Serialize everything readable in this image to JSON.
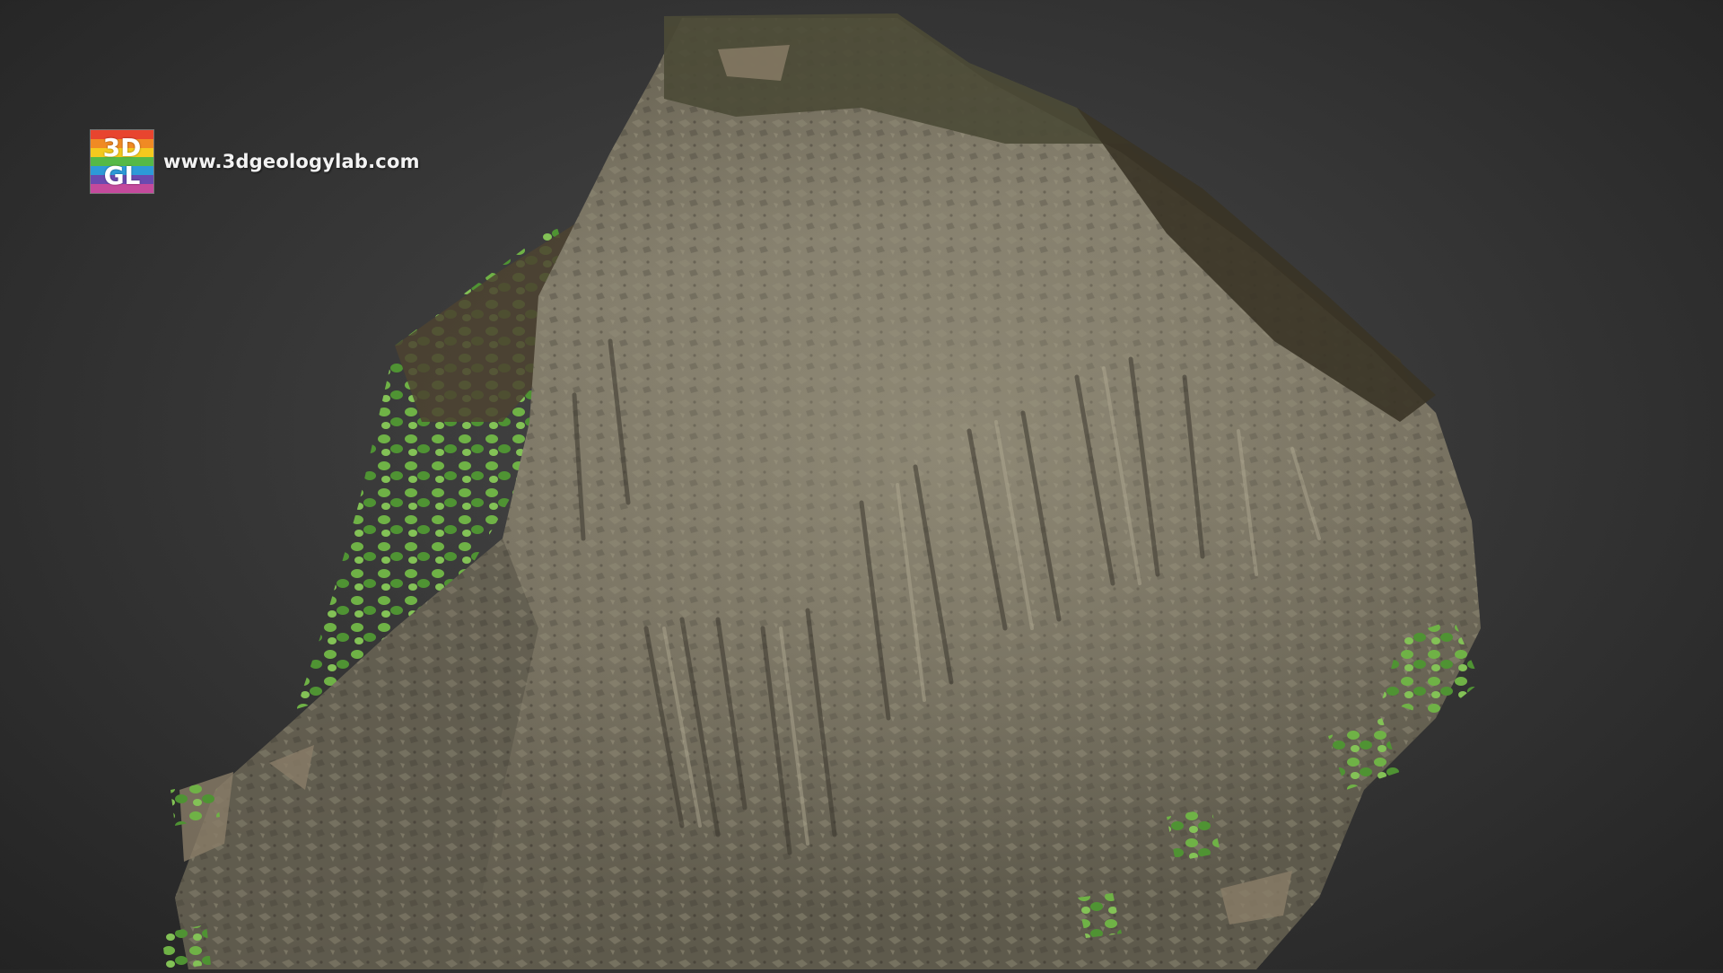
{
  "watermark": {
    "logo_line1": "3D",
    "logo_line2": "GL",
    "url": "www.3dgeologylab.com",
    "logo_colors": [
      "#e8452f",
      "#f08a24",
      "#f4c91e",
      "#55b947",
      "#2d9ad8",
      "#6a4ab0",
      "#c44a9c"
    ]
  },
  "scene": {
    "subject": "rock-outcrop-3d-model",
    "colors": {
      "rock_base": "#6f6a5c",
      "rock_light": "#9c9682",
      "rock_dark": "#3f3b33",
      "vegetation": "#5a9a3a",
      "soil": "#4d4331",
      "background_center": "#4a4a4a",
      "background_edge": "#232323"
    }
  }
}
